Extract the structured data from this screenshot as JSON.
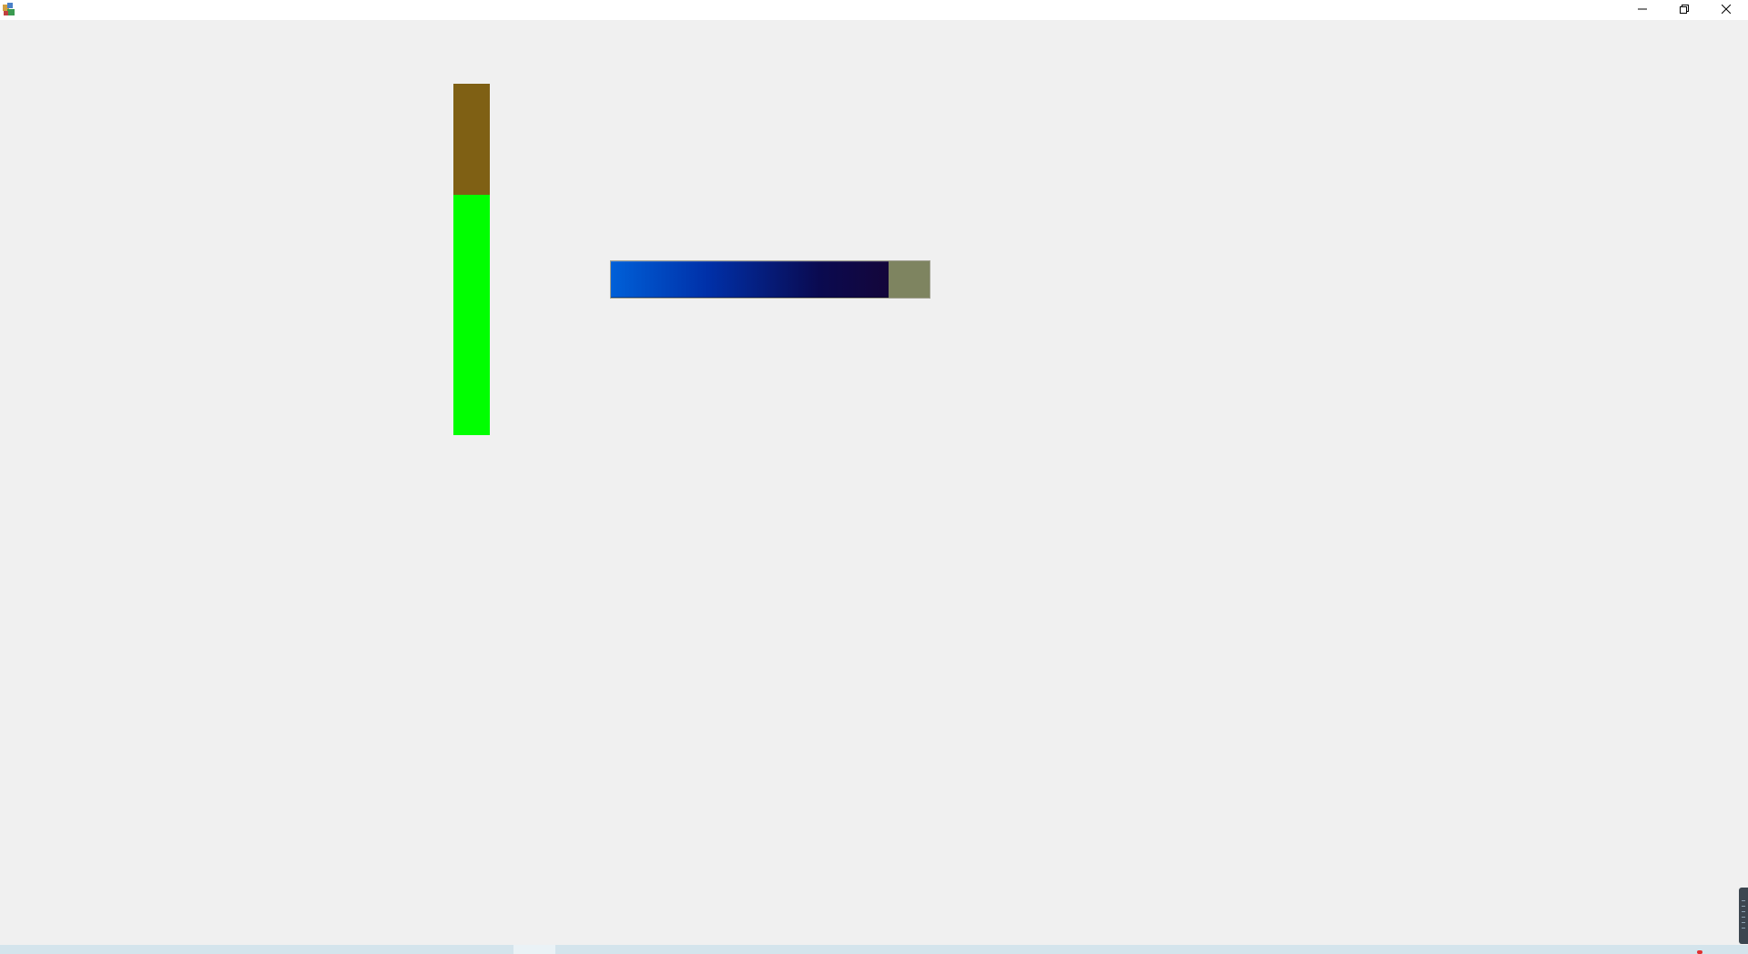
{
  "window": {
    "controls": {
      "minimize_icon": "minimize-icon",
      "maximize_icon": "restore-icon",
      "close_icon": "close-icon"
    }
  },
  "progress": {
    "vertical": {
      "value_fraction": 0.685,
      "fill_color": "#00ff00",
      "track_color": "#7f6014"
    },
    "horizontal": {
      "value_fraction": 0.87,
      "fill_color": "#0030a8",
      "track_color": "#7e8460"
    }
  }
}
